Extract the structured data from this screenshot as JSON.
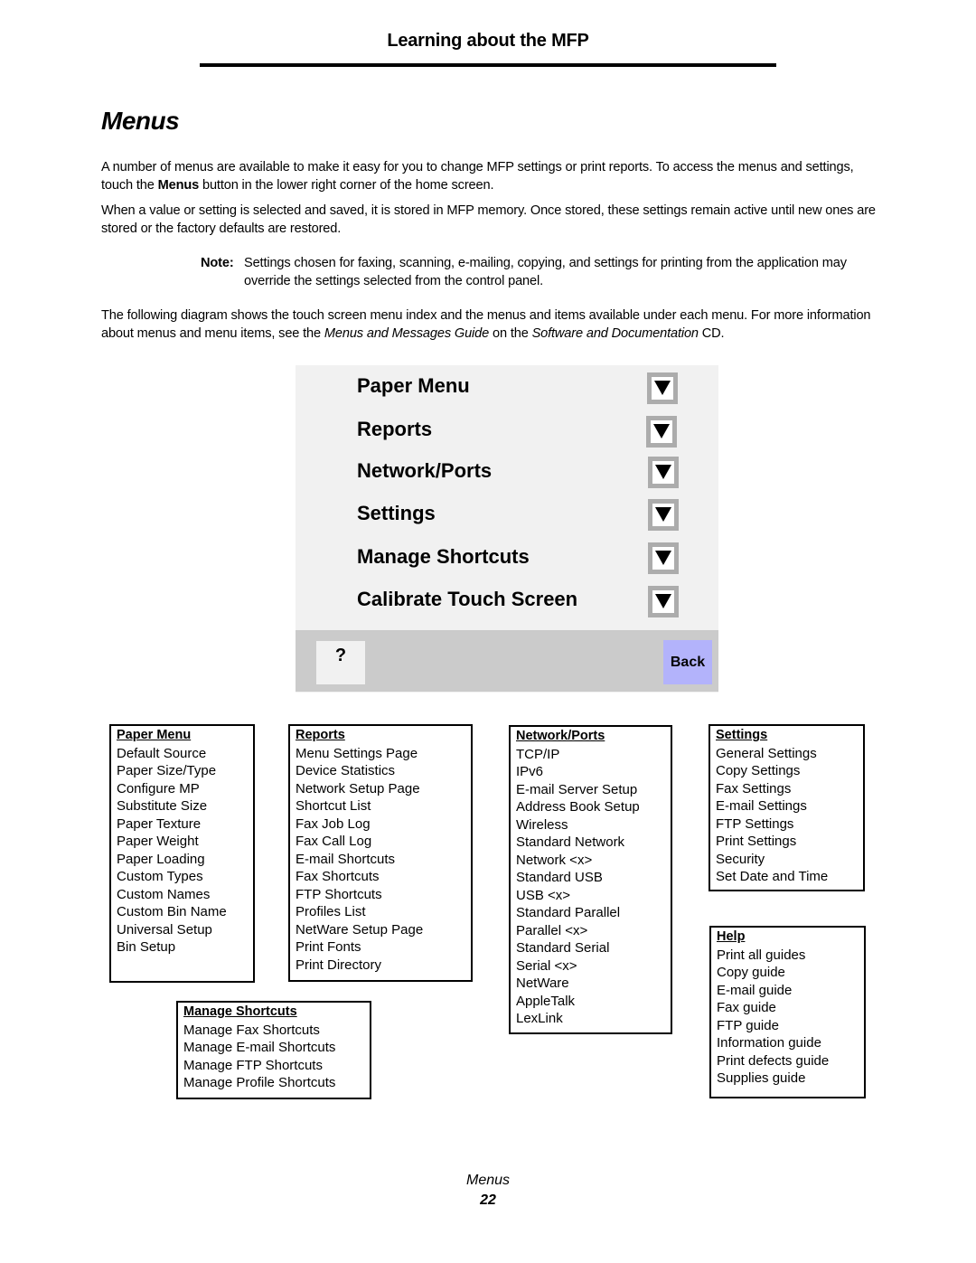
{
  "header": {
    "title": "Learning about the MFP"
  },
  "page_title": "Menus",
  "paragraphs": {
    "p1_before": "A number of menus are available to make it easy for you to change MFP settings or print reports. To access the menus and settings, touch the ",
    "p1_bold": "Menus",
    "p1_after": " button in the lower right corner of the home screen.",
    "p2": "When a value or setting is selected and saved, it is stored in MFP memory. Once stored, these settings remain active until new ones are stored or the factory defaults are restored.",
    "note_label": "Note:",
    "note_text": "Settings chosen for faxing, scanning, e-mailing, copying, and settings for printing from the application may override the settings selected from the control panel.",
    "p3_before": "The following diagram shows the touch screen menu index and the menus and items available under each menu. For more information about menus and menu items, see the ",
    "p3_italic1": "Menus and Messages Guide",
    "p3_mid": " on the ",
    "p3_italic2": "Software and Documentation",
    "p3_after": " CD."
  },
  "touch_screen": {
    "menus": [
      {
        "label": "Paper Menu",
        "icon": "down-arrow-icon"
      },
      {
        "label": "Reports",
        "icon": "down-arrow-icon"
      },
      {
        "label": "Network/Ports",
        "icon": "down-arrow-icon"
      },
      {
        "label": "Settings",
        "icon": "down-arrow-icon"
      },
      {
        "label": "Manage Shortcuts",
        "icon": "down-arrow-icon"
      },
      {
        "label": "Calibrate Touch Screen",
        "icon": "down-arrow-icon"
      }
    ],
    "help_label": "?",
    "back_label": "Back",
    "colors": {
      "panel_bg": "#f1f1f1",
      "footer_bg": "#cbcbcb",
      "arrow_button_bg": "#acacac",
      "back_button_bg": "#b3b3fb"
    }
  },
  "menu_boxes": {
    "paper_menu": {
      "title": "Paper Menu",
      "items": [
        "Default Source",
        "Paper Size/Type",
        "Configure MP",
        "Substitute Size",
        "Paper Texture",
        "Paper Weight",
        "Paper Loading",
        "Custom Types",
        "Custom Names",
        "Custom Bin Name",
        "Universal Setup",
        "Bin Setup"
      ]
    },
    "reports": {
      "title": "Reports",
      "items": [
        "Menu Settings Page",
        "Device Statistics",
        "Network Setup Page",
        "Shortcut List",
        "Fax Job Log",
        "Fax Call Log",
        "E-mail Shortcuts",
        "Fax Shortcuts",
        "FTP Shortcuts",
        "Profiles List",
        "NetWare Setup Page",
        "Print Fonts",
        "Print Directory"
      ]
    },
    "network_ports": {
      "title": "Network/Ports",
      "items": [
        "TCP/IP",
        "IPv6",
        "E-mail Server Setup",
        "Address Book Setup",
        "Wireless",
        "Standard Network",
        "Network <x>",
        "Standard USB",
        "USB <x>",
        "Standard Parallel",
        "Parallel <x>",
        "Standard Serial",
        "Serial <x>",
        "NetWare",
        "AppleTalk",
        "LexLink"
      ]
    },
    "settings": {
      "title": "Settings",
      "items": [
        "General Settings",
        "Copy Settings",
        "Fax Settings",
        "E-mail Settings",
        "FTP Settings",
        "Print Settings",
        "Security",
        "Set Date and Time"
      ]
    },
    "help": {
      "title": "Help",
      "items": [
        "Print all guides",
        "Copy guide",
        "E-mail guide",
        "Fax guide",
        "FTP guide",
        "Information guide",
        "Print defects guide",
        "Supplies guide"
      ]
    },
    "manage_shortcuts": {
      "title": "Manage Shortcuts",
      "items": [
        "Manage Fax Shortcuts",
        "Manage E-mail Shortcuts",
        "Manage FTP Shortcuts",
        "Manage Profile Shortcuts"
      ]
    }
  },
  "footer": {
    "section": "Menus",
    "page_number": "22"
  }
}
